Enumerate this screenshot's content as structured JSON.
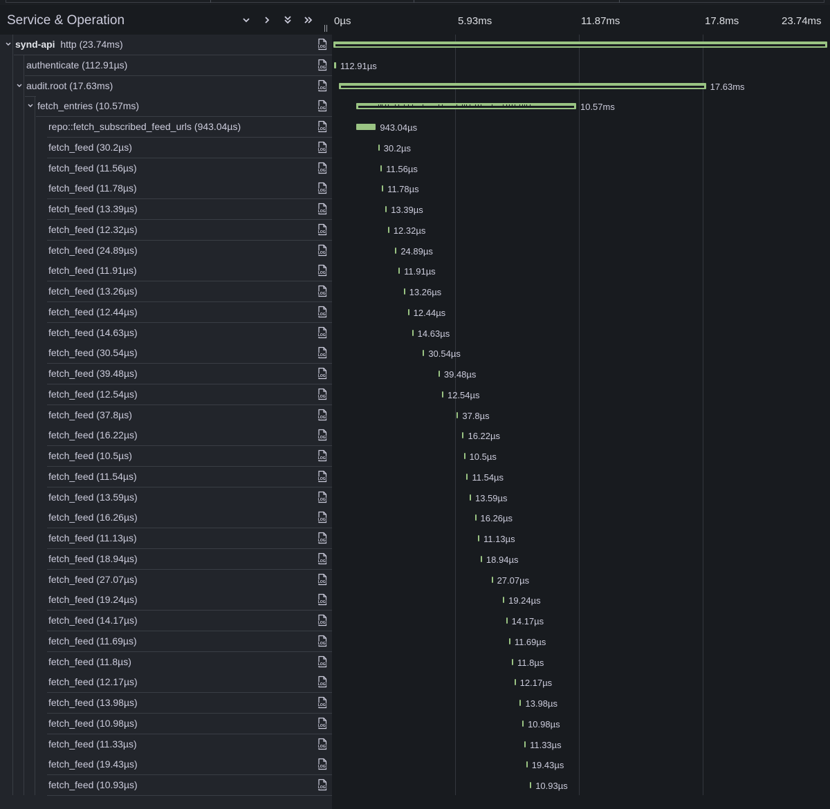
{
  "header": {
    "title": "Service & Operation",
    "ticks": [
      "0µs",
      "5.93ms",
      "11.87ms",
      "17.8ms",
      "23.74ms"
    ]
  },
  "colors": {
    "bar": "#9ac483",
    "background": "#181b1f",
    "left_pane": "#22252b"
  },
  "rows": [
    {
      "name": "synd-api",
      "op": "http (23.74ms)",
      "duration": "23.74ms",
      "start_ms": 0,
      "dur_ms": 23.74,
      "depth": 0,
      "expandable": true
    },
    {
      "name": "authenticate (112.91µs)",
      "duration": "112.91µs",
      "start_ms": 0.02,
      "dur_ms": 0.11,
      "depth": 1
    },
    {
      "name": "audit.root (17.63ms)",
      "duration": "17.63ms",
      "start_ms": 0.28,
      "dur_ms": 17.63,
      "depth": 1,
      "expandable": true
    },
    {
      "name": "fetch_entries (10.57ms)",
      "duration": "10.57ms",
      "start_ms": 1.1,
      "dur_ms": 10.57,
      "depth": 2,
      "expandable": true
    },
    {
      "name": "repo::fetch_subscribed_feed_urls (943.04µs)",
      "duration": "943.04µs",
      "start_ms": 1.1,
      "dur_ms": 0.94,
      "depth": 3
    },
    {
      "name": "fetch_feed (30.2µs)",
      "duration": "30.2µs",
      "start_ms": 2.15,
      "dur_ms": 0.03,
      "depth": 3
    },
    {
      "name": "fetch_feed (11.56µs)",
      "duration": "11.56µs",
      "start_ms": 2.27,
      "dur_ms": 0.012,
      "depth": 3
    },
    {
      "name": "fetch_feed (11.78µs)",
      "duration": "11.78µs",
      "start_ms": 2.33,
      "dur_ms": 0.012,
      "depth": 3
    },
    {
      "name": "fetch_feed (13.39µs)",
      "duration": "13.39µs",
      "start_ms": 2.5,
      "dur_ms": 0.013,
      "depth": 3
    },
    {
      "name": "fetch_feed (12.32µs)",
      "duration": "12.32µs",
      "start_ms": 2.62,
      "dur_ms": 0.012,
      "depth": 3
    },
    {
      "name": "fetch_feed (24.89µs)",
      "duration": "24.89µs",
      "start_ms": 2.97,
      "dur_ms": 0.025,
      "depth": 3
    },
    {
      "name": "fetch_feed (11.91µs)",
      "duration": "11.91µs",
      "start_ms": 3.13,
      "dur_ms": 0.012,
      "depth": 3
    },
    {
      "name": "fetch_feed (13.26µs)",
      "duration": "13.26µs",
      "start_ms": 3.38,
      "dur_ms": 0.013,
      "depth": 3
    },
    {
      "name": "fetch_feed (12.44µs)",
      "duration": "12.44µs",
      "start_ms": 3.58,
      "dur_ms": 0.012,
      "depth": 3
    },
    {
      "name": "fetch_feed (14.63µs)",
      "duration": "14.63µs",
      "start_ms": 3.78,
      "dur_ms": 0.015,
      "depth": 3
    },
    {
      "name": "fetch_feed (30.54µs)",
      "duration": "30.54µs",
      "start_ms": 4.3,
      "dur_ms": 0.031,
      "depth": 3
    },
    {
      "name": "fetch_feed (39.48µs)",
      "duration": "39.48µs",
      "start_ms": 5.05,
      "dur_ms": 0.039,
      "depth": 3
    },
    {
      "name": "fetch_feed (12.54µs)",
      "duration": "12.54µs",
      "start_ms": 5.22,
      "dur_ms": 0.013,
      "depth": 3
    },
    {
      "name": "fetch_feed (37.8µs)",
      "duration": "37.8µs",
      "start_ms": 5.93,
      "dur_ms": 0.038,
      "depth": 3
    },
    {
      "name": "fetch_feed (16.22µs)",
      "duration": "16.22µs",
      "start_ms": 6.2,
      "dur_ms": 0.016,
      "depth": 3
    },
    {
      "name": "fetch_feed (10.5µs)",
      "duration": "10.5µs",
      "start_ms": 6.27,
      "dur_ms": 0.011,
      "depth": 3
    },
    {
      "name": "fetch_feed (11.54µs)",
      "duration": "11.54µs",
      "start_ms": 6.4,
      "dur_ms": 0.012,
      "depth": 3
    },
    {
      "name": "fetch_feed (13.59µs)",
      "duration": "13.59µs",
      "start_ms": 6.55,
      "dur_ms": 0.014,
      "depth": 3
    },
    {
      "name": "fetch_feed (16.26µs)",
      "duration": "16.26µs",
      "start_ms": 6.8,
      "dur_ms": 0.016,
      "depth": 3
    },
    {
      "name": "fetch_feed (11.13µs)",
      "duration": "11.13µs",
      "start_ms": 6.95,
      "dur_ms": 0.011,
      "depth": 3
    },
    {
      "name": "fetch_feed (18.94µs)",
      "duration": "18.94µs",
      "start_ms": 7.08,
      "dur_ms": 0.019,
      "depth": 3
    },
    {
      "name": "fetch_feed (27.07µs)",
      "duration": "27.07µs",
      "start_ms": 7.6,
      "dur_ms": 0.027,
      "depth": 3
    },
    {
      "name": "fetch_feed (19.24µs)",
      "duration": "19.24µs",
      "start_ms": 8.15,
      "dur_ms": 0.019,
      "depth": 3
    },
    {
      "name": "fetch_feed (14.17µs)",
      "duration": "14.17µs",
      "start_ms": 8.3,
      "dur_ms": 0.014,
      "depth": 3
    },
    {
      "name": "fetch_feed (11.69µs)",
      "duration": "11.69µs",
      "start_ms": 8.44,
      "dur_ms": 0.012,
      "depth": 3
    },
    {
      "name": "fetch_feed (11.8µs)",
      "duration": "11.8µs",
      "start_ms": 8.58,
      "dur_ms": 0.012,
      "depth": 3
    },
    {
      "name": "fetch_feed (12.17µs)",
      "duration": "12.17µs",
      "start_ms": 8.7,
      "dur_ms": 0.012,
      "depth": 3
    },
    {
      "name": "fetch_feed (13.98µs)",
      "duration": "13.98µs",
      "start_ms": 8.96,
      "dur_ms": 0.014,
      "depth": 3
    },
    {
      "name": "fetch_feed (10.98µs)",
      "duration": "10.98µs",
      "start_ms": 9.08,
      "dur_ms": 0.011,
      "depth": 3
    },
    {
      "name": "fetch_feed (11.33µs)",
      "duration": "11.33µs",
      "start_ms": 9.18,
      "dur_ms": 0.011,
      "depth": 3
    },
    {
      "name": "fetch_feed (19.43µs)",
      "duration": "19.43µs",
      "start_ms": 9.27,
      "dur_ms": 0.019,
      "depth": 3
    },
    {
      "name": "fetch_feed (10.93µs)",
      "duration": "10.93µs",
      "start_ms": 9.45,
      "dur_ms": 0.011,
      "depth": 3
    }
  ]
}
